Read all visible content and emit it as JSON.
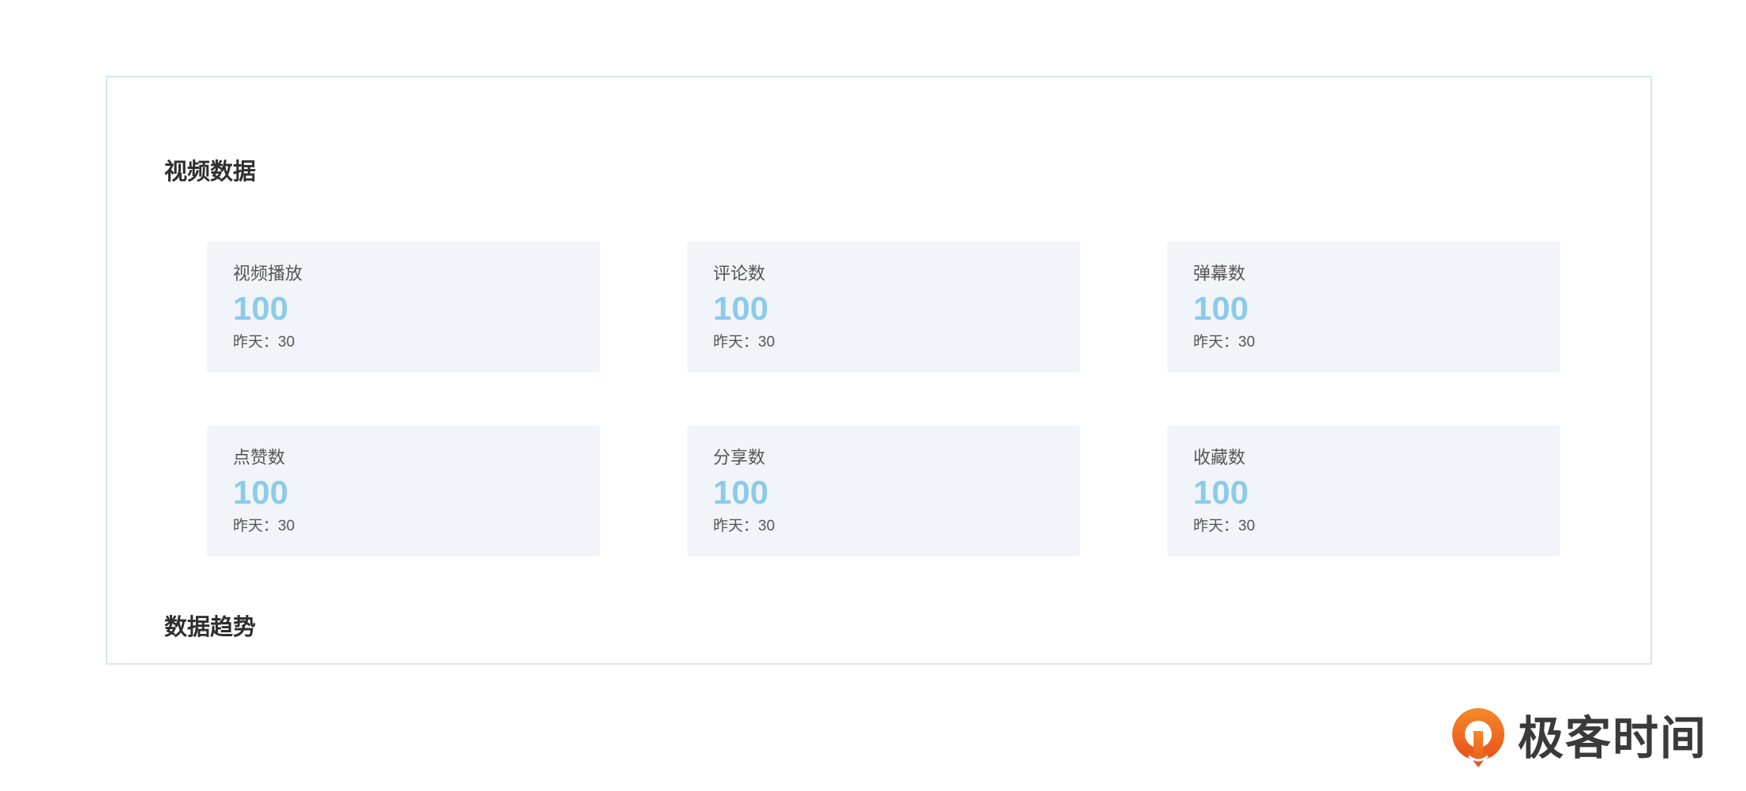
{
  "sections": {
    "video_data_title": "视频数据",
    "trend_title": "数据趋势"
  },
  "cards": [
    {
      "label": "视频播放",
      "value": "100",
      "yesterday": "昨天：30"
    },
    {
      "label": "评论数",
      "value": "100",
      "yesterday": "昨天：30"
    },
    {
      "label": "弹幕数",
      "value": "100",
      "yesterday": "昨天：30"
    },
    {
      "label": "点赞数",
      "value": "100",
      "yesterday": "昨天：30"
    },
    {
      "label": "分享数",
      "value": "100",
      "yesterday": "昨天：30"
    },
    {
      "label": "收藏数",
      "value": "100",
      "yesterday": "昨天：30"
    }
  ],
  "brand": {
    "name": "极客时间",
    "icon": "geektime-logo-icon"
  },
  "colors": {
    "value_accent": "#8ccbe8",
    "card_bg": "#f1f5f9",
    "panel_border": "#d4e6ef",
    "brand_orange": "#f26a1b"
  }
}
